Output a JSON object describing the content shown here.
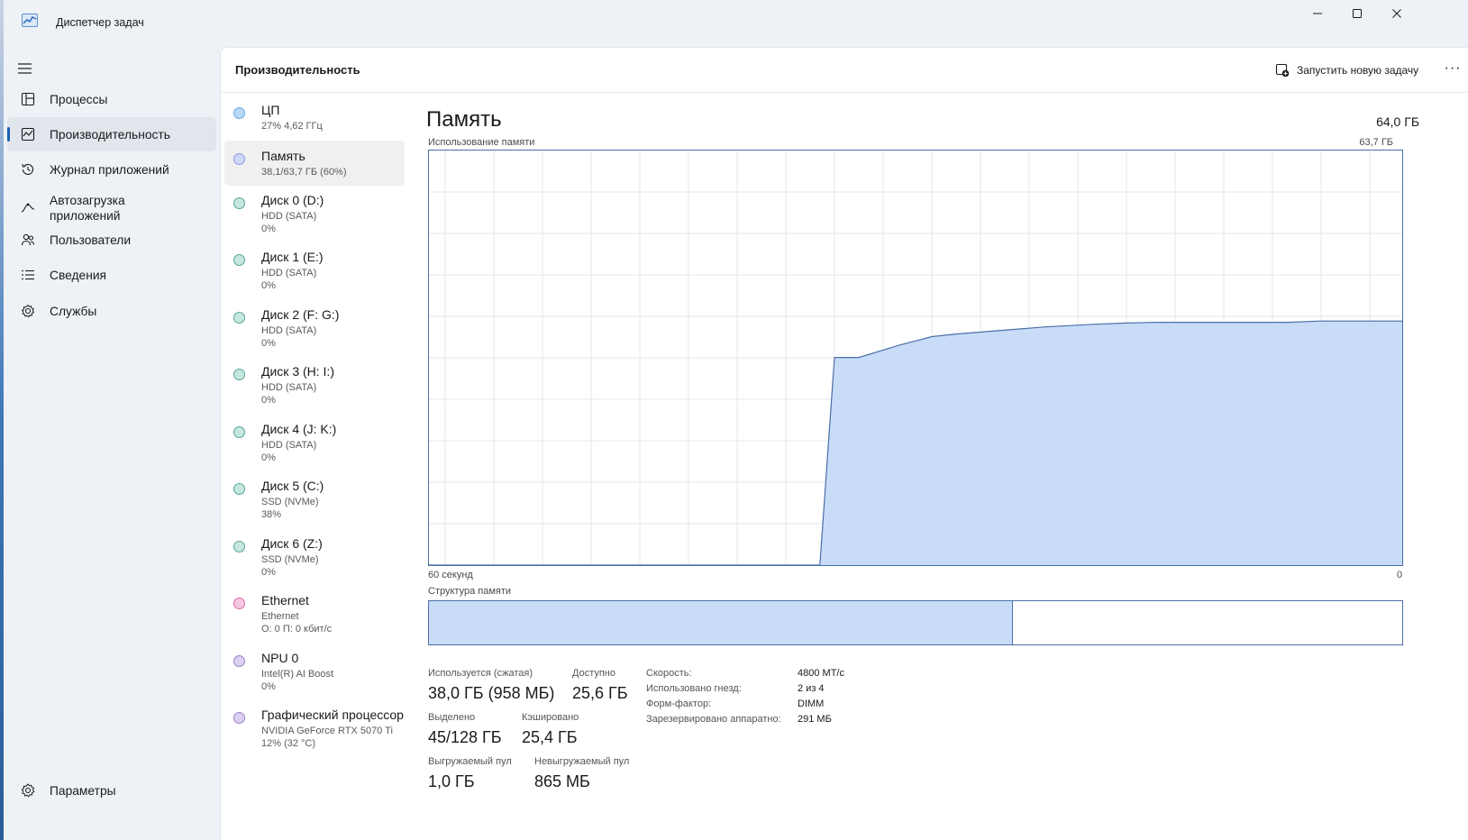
{
  "window": {
    "title": "Диспетчер задач"
  },
  "nav": {
    "items": [
      {
        "label": "Процессы",
        "icon": "processes-icon"
      },
      {
        "label": "Производительность",
        "icon": "performance-icon"
      },
      {
        "label": "Журнал приложений",
        "icon": "history-icon"
      },
      {
        "label": "Автозагрузка\nприложений",
        "icon": "startup-icon"
      },
      {
        "label": "Пользователи",
        "icon": "users-icon"
      },
      {
        "label": "Сведения",
        "icon": "details-icon"
      },
      {
        "label": "Службы",
        "icon": "services-icon"
      }
    ],
    "settings_label": "Параметры"
  },
  "header": {
    "title": "Производительность",
    "run_task_label": "Запустить новую задачу",
    "more_label": "···"
  },
  "resources": [
    {
      "name": "ЦП",
      "sub1": "27%  4,62 ГГц",
      "sub2": "",
      "color": "#6aa9e8",
      "fill": "#b9d7f6"
    },
    {
      "name": "Память",
      "sub1": "38,1/63,7 ГБ (60%)",
      "sub2": "",
      "color": "#8a9ae0",
      "fill": "#cfd6f6"
    },
    {
      "name": "Диск 0 (D:)",
      "sub1": "HDD (SATA)",
      "sub2": "0%",
      "color": "#5aa59a",
      "fill": "#c6e6e0"
    },
    {
      "name": "Диск 1 (E:)",
      "sub1": "HDD (SATA)",
      "sub2": "0%",
      "color": "#5aa59a",
      "fill": "#c6e6e0"
    },
    {
      "name": "Диск 2 (F: G:)",
      "sub1": "HDD (SATA)",
      "sub2": "0%",
      "color": "#5aa59a",
      "fill": "#c6e6e0"
    },
    {
      "name": "Диск 3 (H: I:)",
      "sub1": "HDD (SATA)",
      "sub2": "0%",
      "color": "#5aa59a",
      "fill": "#c6e6e0"
    },
    {
      "name": "Диск 4 (J: K:)",
      "sub1": "HDD (SATA)",
      "sub2": "0%",
      "color": "#5aa59a",
      "fill": "#c6e6e0"
    },
    {
      "name": "Диск 5 (C:)",
      "sub1": "SSD (NVMe)",
      "sub2": "38%",
      "color": "#5aa59a",
      "fill": "#c6e6e0"
    },
    {
      "name": "Диск 6 (Z:)",
      "sub1": "SSD (NVMe)",
      "sub2": "0%",
      "color": "#5aa59a",
      "fill": "#c6e6e0"
    },
    {
      "name": "Ethernet",
      "sub1": "Ethernet",
      "sub2": "О: 0 П: 0 кбит/с",
      "color": "#d96aa8",
      "fill": "#f4c8e2"
    },
    {
      "name": "NPU 0",
      "sub1": "Intel(R) AI Boost",
      "sub2": "0%",
      "color": "#9a82c8",
      "fill": "#dcd0f0"
    },
    {
      "name": "Графический процессор",
      "sub1": "NVIDIA GeForce RTX 5070 Ti",
      "sub2": "12%  (32 °C)",
      "color": "#9a82c8",
      "fill": "#dcd0f0"
    }
  ],
  "memory": {
    "title": "Память",
    "total": "64,0 ГБ",
    "usage_label": "Использование памяти",
    "usage_max": "63,7 ГБ",
    "axis_left": "60 секунд",
    "axis_right": "0",
    "composition_label": "Структура памяти",
    "composition_used_fraction": 0.6,
    "stats": {
      "in_use_label": "Используется (сжатая)",
      "in_use_value": "38,0 ГБ (958 МБ)",
      "available_label": "Доступно",
      "available_value": "25,6 ГБ",
      "committed_label": "Выделено",
      "committed_value": "45/128 ГБ",
      "cached_label": "Кэшировано",
      "cached_value": "25,4 ГБ",
      "paged_label": "Выгружаемый пул",
      "paged_value": "1,0 ГБ",
      "nonpaged_label": "Невыгружаемый пул",
      "nonpaged_value": "865 МБ"
    },
    "specs": {
      "speed_label": "Скорость:",
      "speed_value": "4800 МТ/с",
      "slots_label": "Использовано гнезд:",
      "slots_value": "2 из 4",
      "form_label": "Форм-фактор:",
      "form_value": "DIMM",
      "reserved_label": "Зарезервировано аппаратно:",
      "reserved_value": "291 МБ"
    }
  },
  "chart_data": {
    "type": "area",
    "title": "Использование памяти",
    "xlabel": "",
    "ylabel": "",
    "xlim": [
      60,
      0
    ],
    "ylim": [
      0,
      63.7
    ],
    "grid": true,
    "series": [
      {
        "name": "",
        "x": [
          60,
          35.9,
          35,
          33.5,
          31,
          29,
          27.5,
          25,
          22,
          19,
          17,
          15,
          13,
          11,
          9,
          7,
          5,
          3,
          1,
          0
        ],
        "y": [
          0,
          0,
          31.9,
          31.9,
          33.8,
          35.1,
          35.5,
          36.0,
          36.6,
          37.0,
          37.2,
          37.3,
          37.3,
          37.3,
          37.3,
          37.3,
          37.5,
          37.5,
          37.5,
          37.5
        ]
      }
    ],
    "colors": {
      "fill": "#c8dcf8",
      "line": "#4a6fa5",
      "grid": "#e3e7ee"
    }
  }
}
